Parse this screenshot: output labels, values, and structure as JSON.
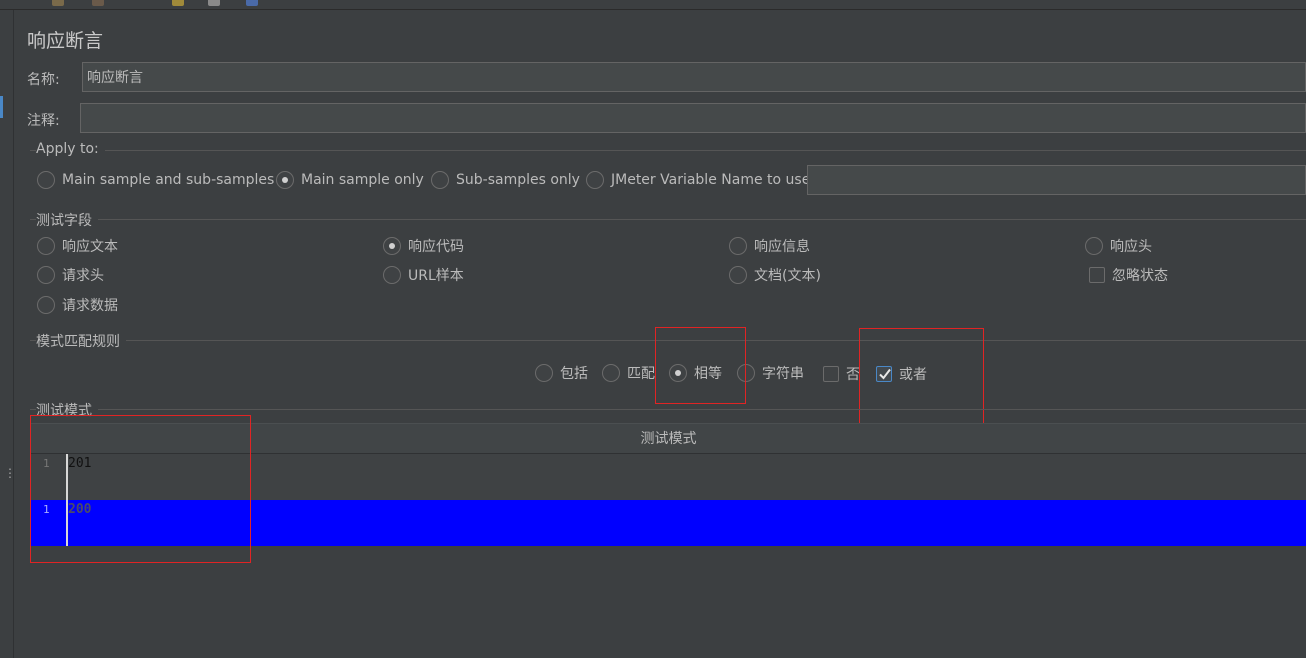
{
  "panel": {
    "title": "响应断言"
  },
  "fields": {
    "name_label": "名称:",
    "name_value": "响应断言",
    "comment_label": "注释:",
    "comment_value": ""
  },
  "apply_to": {
    "title": "Apply to:",
    "options": [
      {
        "label": "Main sample and sub-samples",
        "selected": false
      },
      {
        "label": "Main sample only",
        "selected": true
      },
      {
        "label": "Sub-samples only",
        "selected": false
      },
      {
        "label": "JMeter Variable Name to use",
        "selected": false
      }
    ],
    "variable_value": ""
  },
  "test_field": {
    "title": "测试字段",
    "options": [
      {
        "label": "响应文本",
        "selected": false
      },
      {
        "label": "响应代码",
        "selected": true
      },
      {
        "label": "响应信息",
        "selected": false
      },
      {
        "label": "响应头",
        "selected": false
      },
      {
        "label": "请求头",
        "selected": false
      },
      {
        "label": "URL样本",
        "selected": false
      },
      {
        "label": "文档(文本)",
        "selected": false
      },
      {
        "label": "忽略状态",
        "checked": false
      },
      {
        "label": "请求数据",
        "selected": false
      }
    ]
  },
  "pattern_rules": {
    "title": "模式匹配规则",
    "options": [
      {
        "label": "包括",
        "selected": false
      },
      {
        "label": "匹配",
        "selected": false
      },
      {
        "label": "相等",
        "selected": true
      },
      {
        "label": "字符串",
        "selected": false
      },
      {
        "label": "否",
        "checked": false
      },
      {
        "label": "或者",
        "checked": true
      }
    ]
  },
  "test_patterns": {
    "title": "测试模式",
    "column_header": "测试模式",
    "rows": [
      {
        "line": "1",
        "value": "201"
      },
      {
        "line": "1",
        "value": "200"
      }
    ]
  },
  "colors": {
    "background": "#3c3f41",
    "selection": "#0000ff",
    "highlight_box": "#e02424",
    "check_accent": "#4a88c7"
  }
}
